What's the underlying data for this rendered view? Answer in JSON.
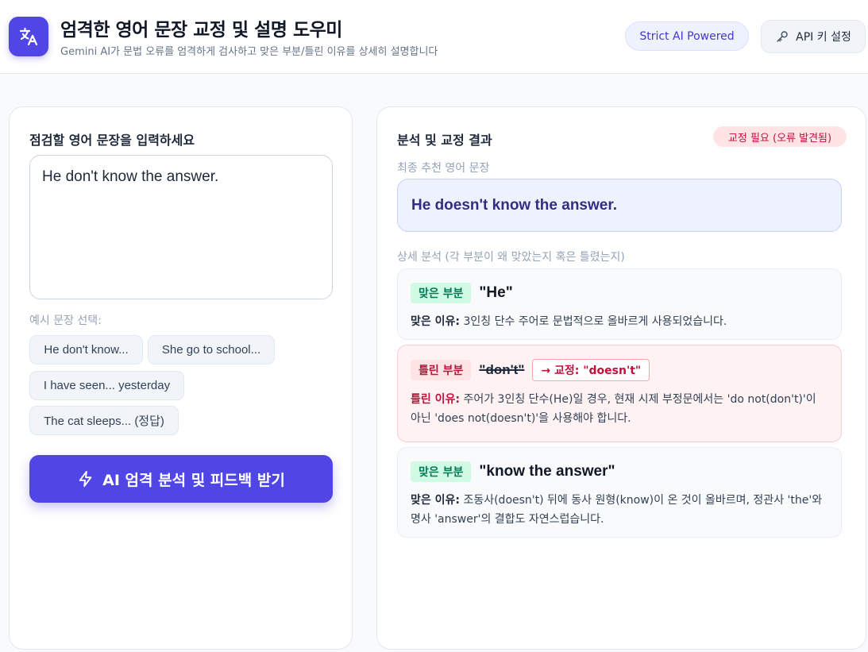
{
  "header": {
    "title": "엄격한 영어 문장 교정 및 설명 도우미",
    "subtitle": "Gemini AI가 문법 오류를 엄격하게 검사하고 맞은 부분/틀린 이유를 상세히 설명합니다",
    "badge": "Strict AI Powered",
    "api_button": "API 키 설정",
    "logo_icon": "translate-icon",
    "accent_color": "#4f46e5"
  },
  "input_panel": {
    "heading": "점검할 영어 문장을 입력하세요",
    "input_value": "He don't know the answer.",
    "examples_label": "예시 문장 선택:",
    "examples": [
      "He don't know...",
      "She go to school...",
      "I have seen... yesterday",
      "The cat sleeps... (정답)"
    ],
    "submit_label": "AI 엄격 분석 및 피드백 받기",
    "submit_icon": "lightning-icon"
  },
  "result_panel": {
    "heading": "분석 및 교정 결과",
    "status": "교정 필요 (오류 발견됨)",
    "final_label": "최종 추천 영어 문장",
    "final_sentence": "He doesn't know the answer.",
    "detail_label": "상세 분석 (각 부분이 왜 맞았는지 혹은 틀렸는지)",
    "items": [
      {
        "status": "correct",
        "tag": "맞은 부분",
        "phrase": "\"He\"",
        "reason_label": "맞은 이유:",
        "reason": "3인칭 단수 주어로 문법적으로 올바르게 사용되었습니다."
      },
      {
        "status": "incorrect",
        "tag": "틀린 부분",
        "phrase": "\"don't\"",
        "correction": "→ 교정: \"doesn't\"",
        "reason_label": "틀린 이유:",
        "reason": "주어가 3인칭 단수(He)일 경우, 현재 시제 부정문에서는 'do not(don't)'이 아닌 'does not(doesn't)'을 사용해야 합니다."
      },
      {
        "status": "correct",
        "tag": "맞은 부분",
        "phrase": "\"know the answer\"",
        "reason_label": "맞은 이유:",
        "reason": "조동사(doesn't) 뒤에 동사 원형(know)이 온 것이 올바르며, 정관사 'the'와 명사 'answer'의 결합도 자연스럽습니다."
      }
    ]
  }
}
